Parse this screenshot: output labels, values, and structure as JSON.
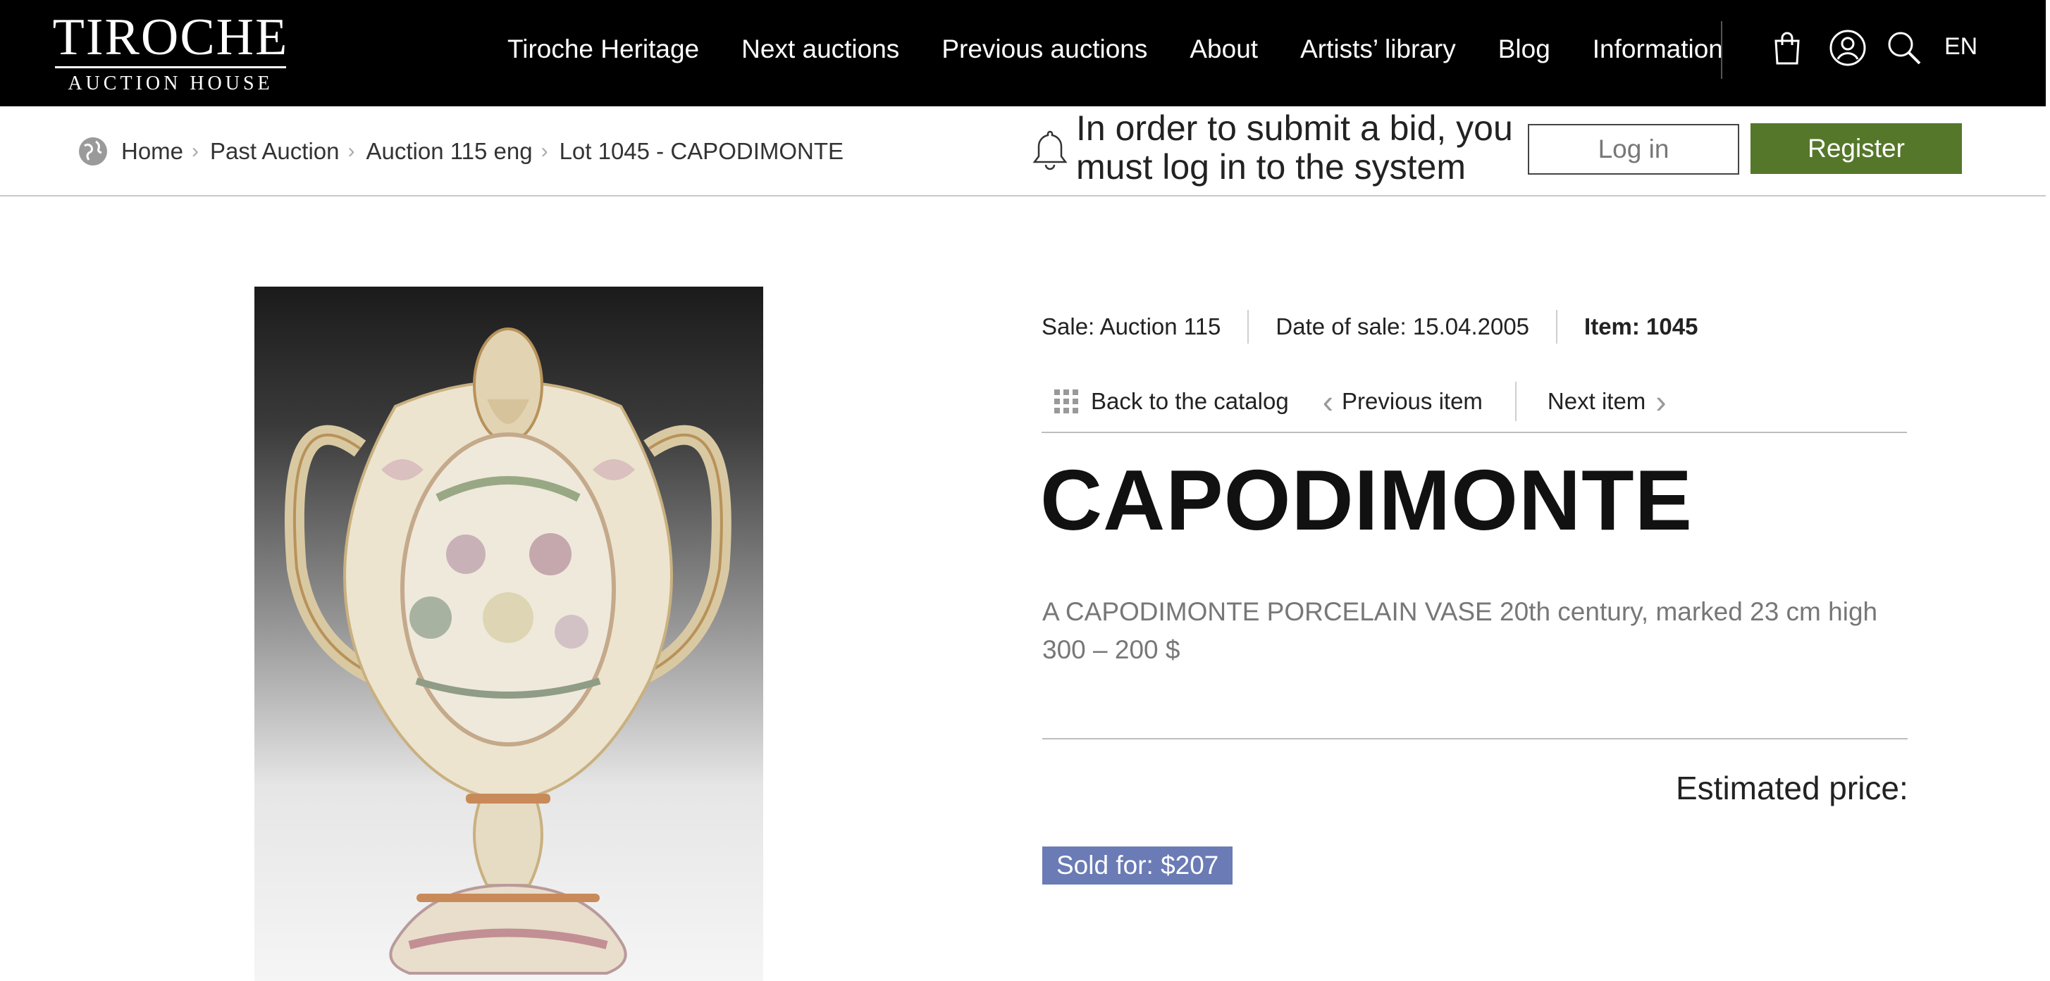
{
  "header": {
    "logo_main": "TIROCHE",
    "logo_sub": "AUCTION HOUSE",
    "nav": [
      {
        "label": "Tiroche Heritage"
      },
      {
        "label": "Next auctions"
      },
      {
        "label": "Previous auctions"
      },
      {
        "label": "About"
      },
      {
        "label": "Artists’ library"
      },
      {
        "label": "Blog"
      },
      {
        "label": "Information"
      }
    ],
    "icons": [
      "shopping-bag-icon",
      "user-icon",
      "search-icon"
    ],
    "language": "EN"
  },
  "breadcrumb": {
    "items": [
      {
        "label": "Home"
      },
      {
        "label": "Past Auction"
      },
      {
        "label": "Auction 115 eng"
      },
      {
        "label": "Lot 1045 - CAPODIMONTE"
      }
    ]
  },
  "bid_bar": {
    "notice": "In order to submit a bid, you must log in to the system",
    "login_label": "Log in",
    "register_label": "Register"
  },
  "lot": {
    "sale": "Sale: Auction 115",
    "date": "Date of sale: 15.04.2005",
    "item": "Item: 1045",
    "back_label": "Back to the catalog",
    "prev_label": "Previous item",
    "next_label": "Next item",
    "title": "CAPODIMONTE",
    "description": "A CAPODIMONTE PORCELAIN VASE 20th century, marked 23 cm high",
    "estimate": "300 – 200 $",
    "estimated_label": "Estimated price:",
    "sold": "Sold for: $207"
  },
  "colors": {
    "header_bg": "#000000",
    "register_bg": "#55772a",
    "sold_badge_bg": "#6a7bb5"
  }
}
